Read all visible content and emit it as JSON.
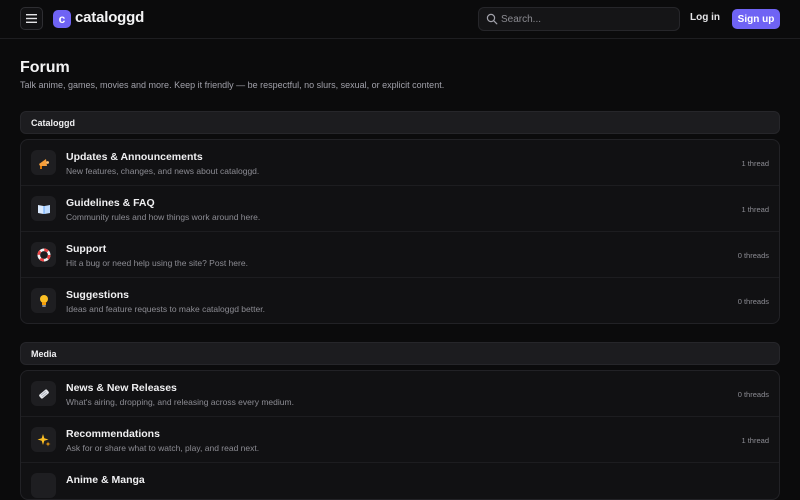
{
  "header": {
    "logo_letter": "c",
    "brand": "cataloggd",
    "search_placeholder": "Search...",
    "login_label": "Log in",
    "signup_label": "Sign up",
    "accent_color": "#6f63f4"
  },
  "page": {
    "title": "Forum",
    "subtitle": "Talk anime, games, movies and more. Keep it friendly — be respectful, no slurs, sexual, or explicit content."
  },
  "sections": [
    {
      "name": "Cataloggd",
      "categories": [
        {
          "icon": "megaphone-icon",
          "title": "Updates & Announcements",
          "description": "New features, changes, and news about cataloggd.",
          "count": "1 thread"
        },
        {
          "icon": "book-icon",
          "title": "Guidelines & FAQ",
          "description": "Community rules and how things work around here.",
          "count": "1 thread"
        },
        {
          "icon": "lifebuoy-icon",
          "title": "Support",
          "description": "Hit a bug or need help using the site? Post here.",
          "count": "0 threads"
        },
        {
          "icon": "lightbulb-icon",
          "title": "Suggestions",
          "description": "Ideas and feature requests to make cataloggd better.",
          "count": "0 threads"
        }
      ]
    },
    {
      "name": "Media",
      "categories": [
        {
          "icon": "newspaper-icon",
          "title": "News & New Releases",
          "description": "What's airing, dropping, and releasing across every medium.",
          "count": "0 threads"
        },
        {
          "icon": "sparkles-icon",
          "title": "Recommendations",
          "description": "Ask for or share what to watch, play, and read next.",
          "count": "1 thread"
        },
        {
          "icon": "manga-icon",
          "title": "Anime & Manga",
          "description": "",
          "count": ""
        }
      ]
    }
  ]
}
